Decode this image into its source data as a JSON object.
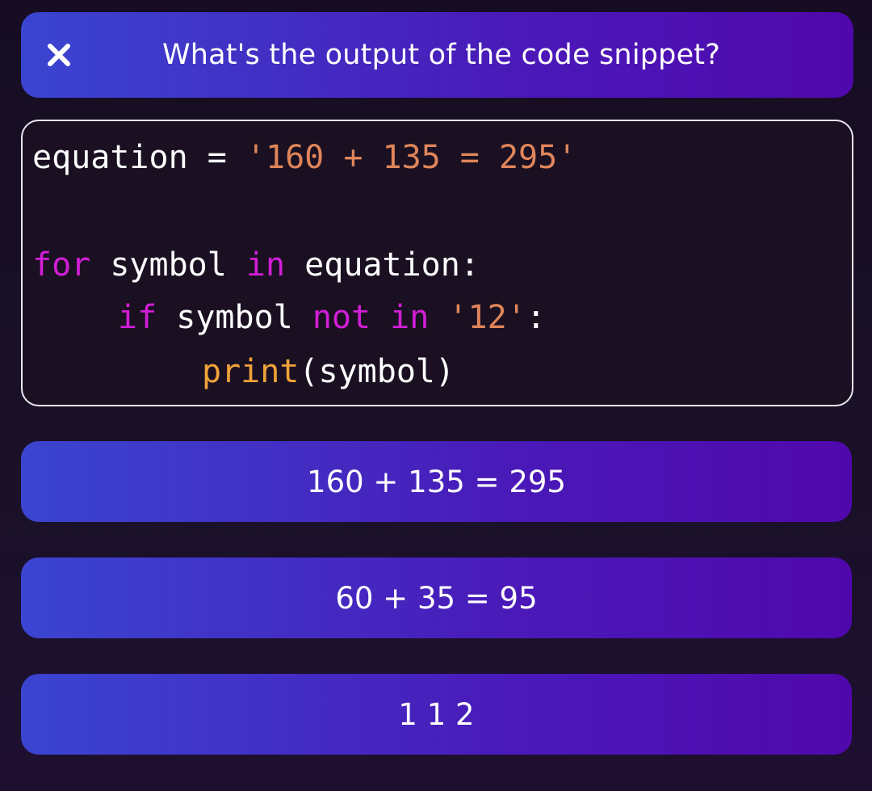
{
  "header": {
    "close_icon": "close-icon",
    "question": "What's the output of the code snippet?"
  },
  "code": {
    "line1": {
      "var": "equation",
      "op": " = ",
      "str": "'160 + 135 = 295'"
    },
    "line3": {
      "kw_for": "for",
      "var": " symbol ",
      "kw_in": "in",
      "rest": " equation:"
    },
    "line4": {
      "kw_if": "if",
      "var": " symbol ",
      "kw_not_in": "not in",
      "space": " ",
      "str": "'12'",
      "colon": ":"
    },
    "line5": {
      "fn": "print",
      "args": "(symbol)"
    }
  },
  "options": [
    {
      "label": "160 + 135 = 295"
    },
    {
      "label": "60 + 35 = 95"
    },
    {
      "label": "1 1 2"
    }
  ],
  "colors": {
    "keyword": "#d21ed6",
    "string": "#e0855a",
    "function": "#f0a23a",
    "accent_start": "#3a45d0",
    "accent_end": "#5008ac"
  }
}
